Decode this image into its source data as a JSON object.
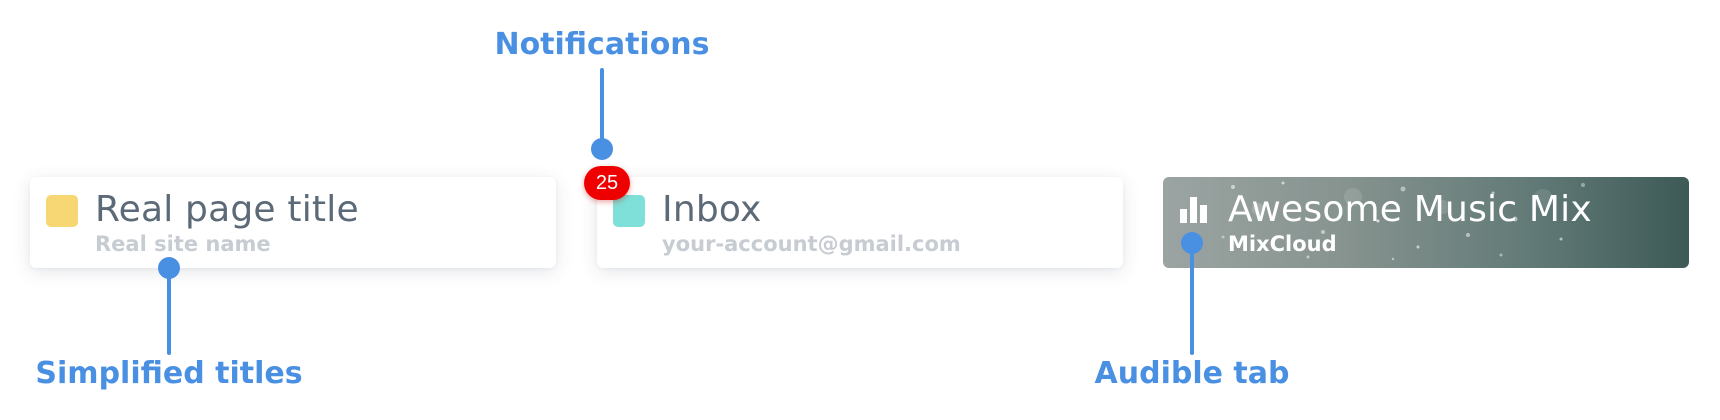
{
  "colors": {
    "annotation": "#4a90e2",
    "favicon_yellow": "#f7d774",
    "favicon_teal": "#7ee0d8",
    "badge": "#ee0000"
  },
  "tabs": [
    {
      "title": "Real page title",
      "subtitle": "Real site name",
      "favicon": "yellow-square-icon"
    },
    {
      "title": "Inbox",
      "subtitle": "your-account@gmail.com",
      "favicon": "teal-square-icon",
      "badge": "25"
    },
    {
      "title": "Awesome Music Mix",
      "subtitle": "MixCloud",
      "favicon": "audio-bars-icon"
    }
  ],
  "annotations": {
    "notifications": "Notifications",
    "simplified_titles": "Simplified titles",
    "audible_tab": "Audible tab"
  }
}
